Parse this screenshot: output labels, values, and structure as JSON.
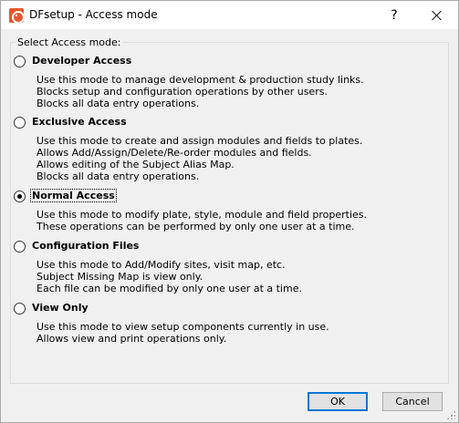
{
  "window": {
    "title": "DFsetup - Access mode",
    "help_glyph": "?"
  },
  "group": {
    "label": "Select Access mode:"
  },
  "options": [
    {
      "label": "Developer Access",
      "checked": false,
      "lines": [
        "Use this mode to manage development & production study links.",
        "Blocks setup and configuration operations by other users.",
        "Blocks all data entry operations."
      ]
    },
    {
      "label": "Exclusive Access",
      "checked": false,
      "lines": [
        "Use this mode to create and assign modules and fields to plates.",
        "Allows Add/Assign/Delete/Re-order modules and fields.",
        "Allows editing of the Subject Alias Map.",
        "Blocks all data entry operations."
      ]
    },
    {
      "label": "Normal Access",
      "checked": true,
      "lines": [
        "Use this mode to modify plate, style, module and field properties.",
        "These operations can be performed by only one user at a time."
      ]
    },
    {
      "label": "Configuration Files",
      "checked": false,
      "lines": [
        "Use this mode to Add/Modify sites, visit map, etc.",
        "Subject Missing Map is view only.",
        "Each file can be modified by only one user at a time."
      ]
    },
    {
      "label": "View Only",
      "checked": false,
      "lines": [
        "Use this mode to view setup components currently in use.",
        "Allows view and print operations only."
      ]
    }
  ],
  "buttons": {
    "ok": "OK",
    "cancel": "Cancel"
  }
}
